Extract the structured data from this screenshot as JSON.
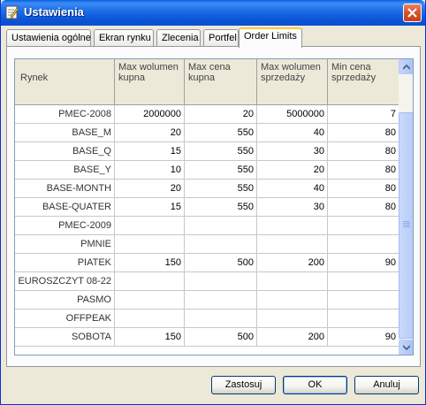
{
  "window": {
    "title": "Ustawienia"
  },
  "tabs": [
    {
      "label": "Ustawienia ogólne",
      "active": false
    },
    {
      "label": "Ekran rynku",
      "active": false
    },
    {
      "label": "Zlecenia",
      "active": false
    },
    {
      "label": "Portfel",
      "active": false
    },
    {
      "label": "Order Limits",
      "active": true
    }
  ],
  "table": {
    "headers": {
      "rynek": "Rynek",
      "max_vol_buy": "Max wolumen kupna",
      "max_price_buy": "Max cena kupna",
      "max_vol_sell": "Max wolumen sprzedaży",
      "min_price_sell": "Min cena sprzedaży"
    },
    "rows": [
      {
        "rynek": "PMEC-2008",
        "max_vol_buy": "2000000",
        "max_price_buy": "20",
        "max_vol_sell": "5000000",
        "min_price_sell": "7"
      },
      {
        "rynek": "BASE_M",
        "max_vol_buy": "20",
        "max_price_buy": "550",
        "max_vol_sell": "40",
        "min_price_sell": "80"
      },
      {
        "rynek": "BASE_Q",
        "max_vol_buy": "15",
        "max_price_buy": "550",
        "max_vol_sell": "30",
        "min_price_sell": "80"
      },
      {
        "rynek": "BASE_Y",
        "max_vol_buy": "10",
        "max_price_buy": "550",
        "max_vol_sell": "20",
        "min_price_sell": "80"
      },
      {
        "rynek": "BASE-MONTH",
        "max_vol_buy": "20",
        "max_price_buy": "550",
        "max_vol_sell": "40",
        "min_price_sell": "80"
      },
      {
        "rynek": "BASE-QUATER",
        "max_vol_buy": "15",
        "max_price_buy": "550",
        "max_vol_sell": "30",
        "min_price_sell": "80"
      },
      {
        "rynek": "PMEC-2009",
        "max_vol_buy": "",
        "max_price_buy": "",
        "max_vol_sell": "",
        "min_price_sell": ""
      },
      {
        "rynek": "PMNIE",
        "max_vol_buy": "",
        "max_price_buy": "",
        "max_vol_sell": "",
        "min_price_sell": ""
      },
      {
        "rynek": "PIATEK",
        "max_vol_buy": "150",
        "max_price_buy": "500",
        "max_vol_sell": "200",
        "min_price_sell": "90"
      },
      {
        "rynek": "EUROSZCZYT 08-22",
        "max_vol_buy": "",
        "max_price_buy": "",
        "max_vol_sell": "",
        "min_price_sell": ""
      },
      {
        "rynek": "PASMO",
        "max_vol_buy": "",
        "max_price_buy": "",
        "max_vol_sell": "",
        "min_price_sell": ""
      },
      {
        "rynek": "OFFPEAK",
        "max_vol_buy": "",
        "max_price_buy": "",
        "max_vol_sell": "",
        "min_price_sell": ""
      },
      {
        "rynek": "SOBOTA",
        "max_vol_buy": "150",
        "max_price_buy": "500",
        "max_vol_sell": "200",
        "min_price_sell": "90"
      }
    ]
  },
  "buttons": {
    "apply": "Zastosuj",
    "ok": "OK",
    "cancel": "Anuluj"
  },
  "icons": {
    "window_icon": "settings-document-icon",
    "close": "close-icon",
    "scroll_up": "chevron-up-icon",
    "scroll_down": "chevron-down-icon"
  },
  "colors": {
    "titlebar": "#0b55d8",
    "active_tab_accent": "#ffc83c",
    "close_button": "#d8502c",
    "window_face": "#ece9d8"
  }
}
